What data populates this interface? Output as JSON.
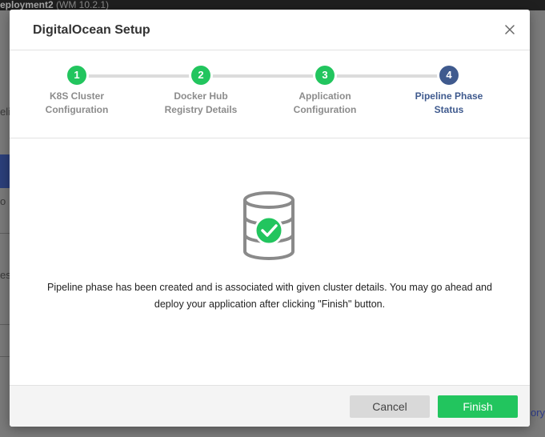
{
  "background": {
    "window_title": "eployment2",
    "window_version": "(WM 10.2.1)",
    "frag_1": "eli",
    "frag_2": "o",
    "frag_3": "es",
    "frag_4": "ory"
  },
  "dialog": {
    "title": "DigitalOcean Setup",
    "steps": [
      {
        "number": "1",
        "label_line1": "K8S Cluster",
        "label_line2": "Configuration",
        "state": "done"
      },
      {
        "number": "2",
        "label_line1": "Docker Hub",
        "label_line2": "Registry Details",
        "state": "done"
      },
      {
        "number": "3",
        "label_line1": "Application",
        "label_line2": "Configuration",
        "state": "done"
      },
      {
        "number": "4",
        "label_line1": "Pipeline Phase",
        "label_line2": "Status",
        "state": "active"
      }
    ],
    "message_line1": "Pipeline phase has been created and is associated with given cluster details. You may go ahead and",
    "message_line2": "deploy your application after clicking \"Finish\" button.",
    "cancel_label": "Cancel",
    "finish_label": "Finish",
    "icons": {
      "close": "close-icon",
      "status": "database-check-icon"
    },
    "colors": {
      "success": "#22c55e",
      "active_step": "#3f5a8e",
      "track": "#dcdcdc"
    }
  }
}
